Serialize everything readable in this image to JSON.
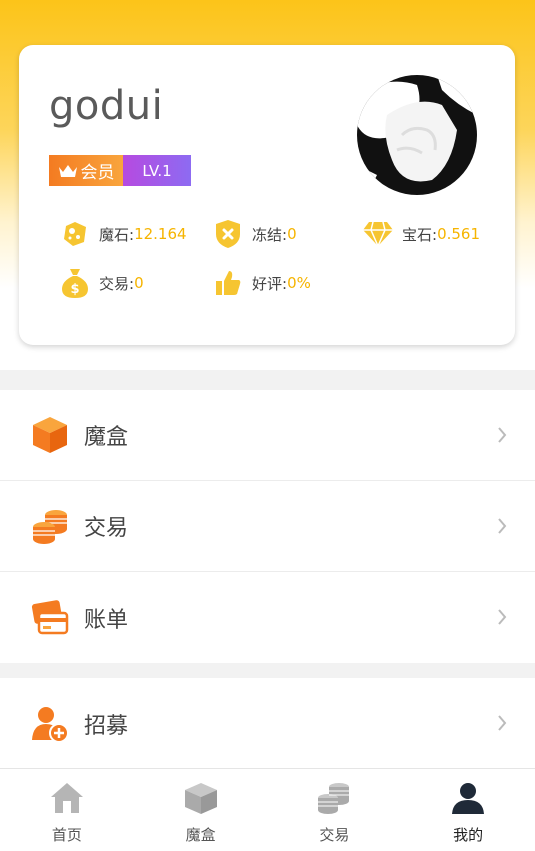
{
  "profile": {
    "username": "godui",
    "badge_member": "会员",
    "badge_level": "LV.1",
    "stats": {
      "mostone_label": "魔石:",
      "mostone_value": "12.164",
      "frozen_label": "冻结:",
      "frozen_value": "0",
      "gem_label": "宝石:",
      "gem_value": "0.561",
      "trade_label": "交易:",
      "trade_value": "0",
      "rating_label": "好评:",
      "rating_value": "0%"
    }
  },
  "menu": {
    "magic_box": "魔盒",
    "trade": "交易",
    "bill": "账单",
    "recruit": "招募"
  },
  "tabbar": {
    "home": "首页",
    "magic_box": "魔盒",
    "trade": "交易",
    "mine": "我的",
    "active": "mine"
  },
  "colors": {
    "accent": "#fcc419",
    "value": "#f6b400",
    "icon_orange": "#f47b21"
  }
}
